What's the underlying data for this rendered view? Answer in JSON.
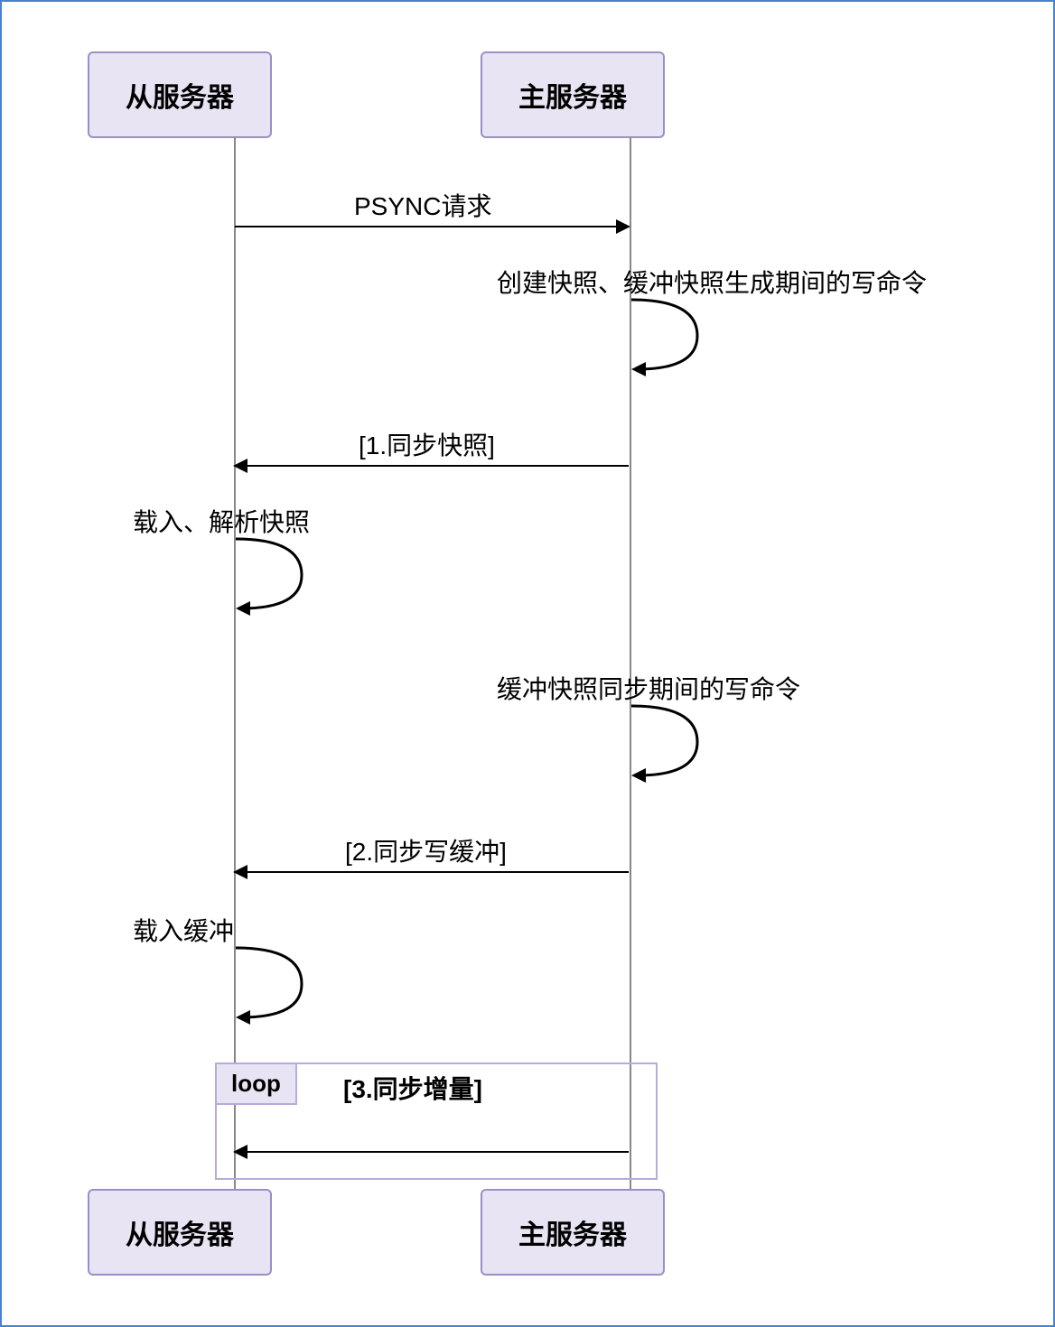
{
  "participants": {
    "slave": "从服务器",
    "master": "主服务器"
  },
  "messages": {
    "psync": "PSYNC请求",
    "create_snapshot": "创建快照、缓冲快照生成期间的写命令",
    "sync_snapshot": "[1.同步快照]",
    "load_parse_snapshot": "载入、解析快照",
    "buffer_sync_cmds": "缓冲快照同步期间的写命令",
    "sync_write_buffer": "[2.同步写缓冲]",
    "load_buffer": "载入缓冲"
  },
  "loop": {
    "tag": "loop",
    "title": "[3.同步增量]"
  },
  "chart_data": {
    "type": "sequence-diagram",
    "participants": [
      "从服务器",
      "主服务器"
    ],
    "interactions": [
      {
        "from": "从服务器",
        "to": "主服务器",
        "label": "PSYNC请求",
        "kind": "message"
      },
      {
        "from": "主服务器",
        "to": "主服务器",
        "label": "创建快照、缓冲快照生成期间的写命令",
        "kind": "self"
      },
      {
        "from": "主服务器",
        "to": "从服务器",
        "label": "[1.同步快照]",
        "kind": "message"
      },
      {
        "from": "从服务器",
        "to": "从服务器",
        "label": "载入、解析快照",
        "kind": "self"
      },
      {
        "from": "主服务器",
        "to": "主服务器",
        "label": "缓冲快照同步期间的写命令",
        "kind": "self"
      },
      {
        "from": "主服务器",
        "to": "从服务器",
        "label": "[2.同步写缓冲]",
        "kind": "message"
      },
      {
        "from": "从服务器",
        "to": "从服务器",
        "label": "载入缓冲",
        "kind": "self"
      },
      {
        "fragment": "loop",
        "label": "[3.同步增量]",
        "interactions": [
          {
            "from": "主服务器",
            "to": "从服务器",
            "label": "",
            "kind": "message"
          }
        ]
      }
    ]
  }
}
